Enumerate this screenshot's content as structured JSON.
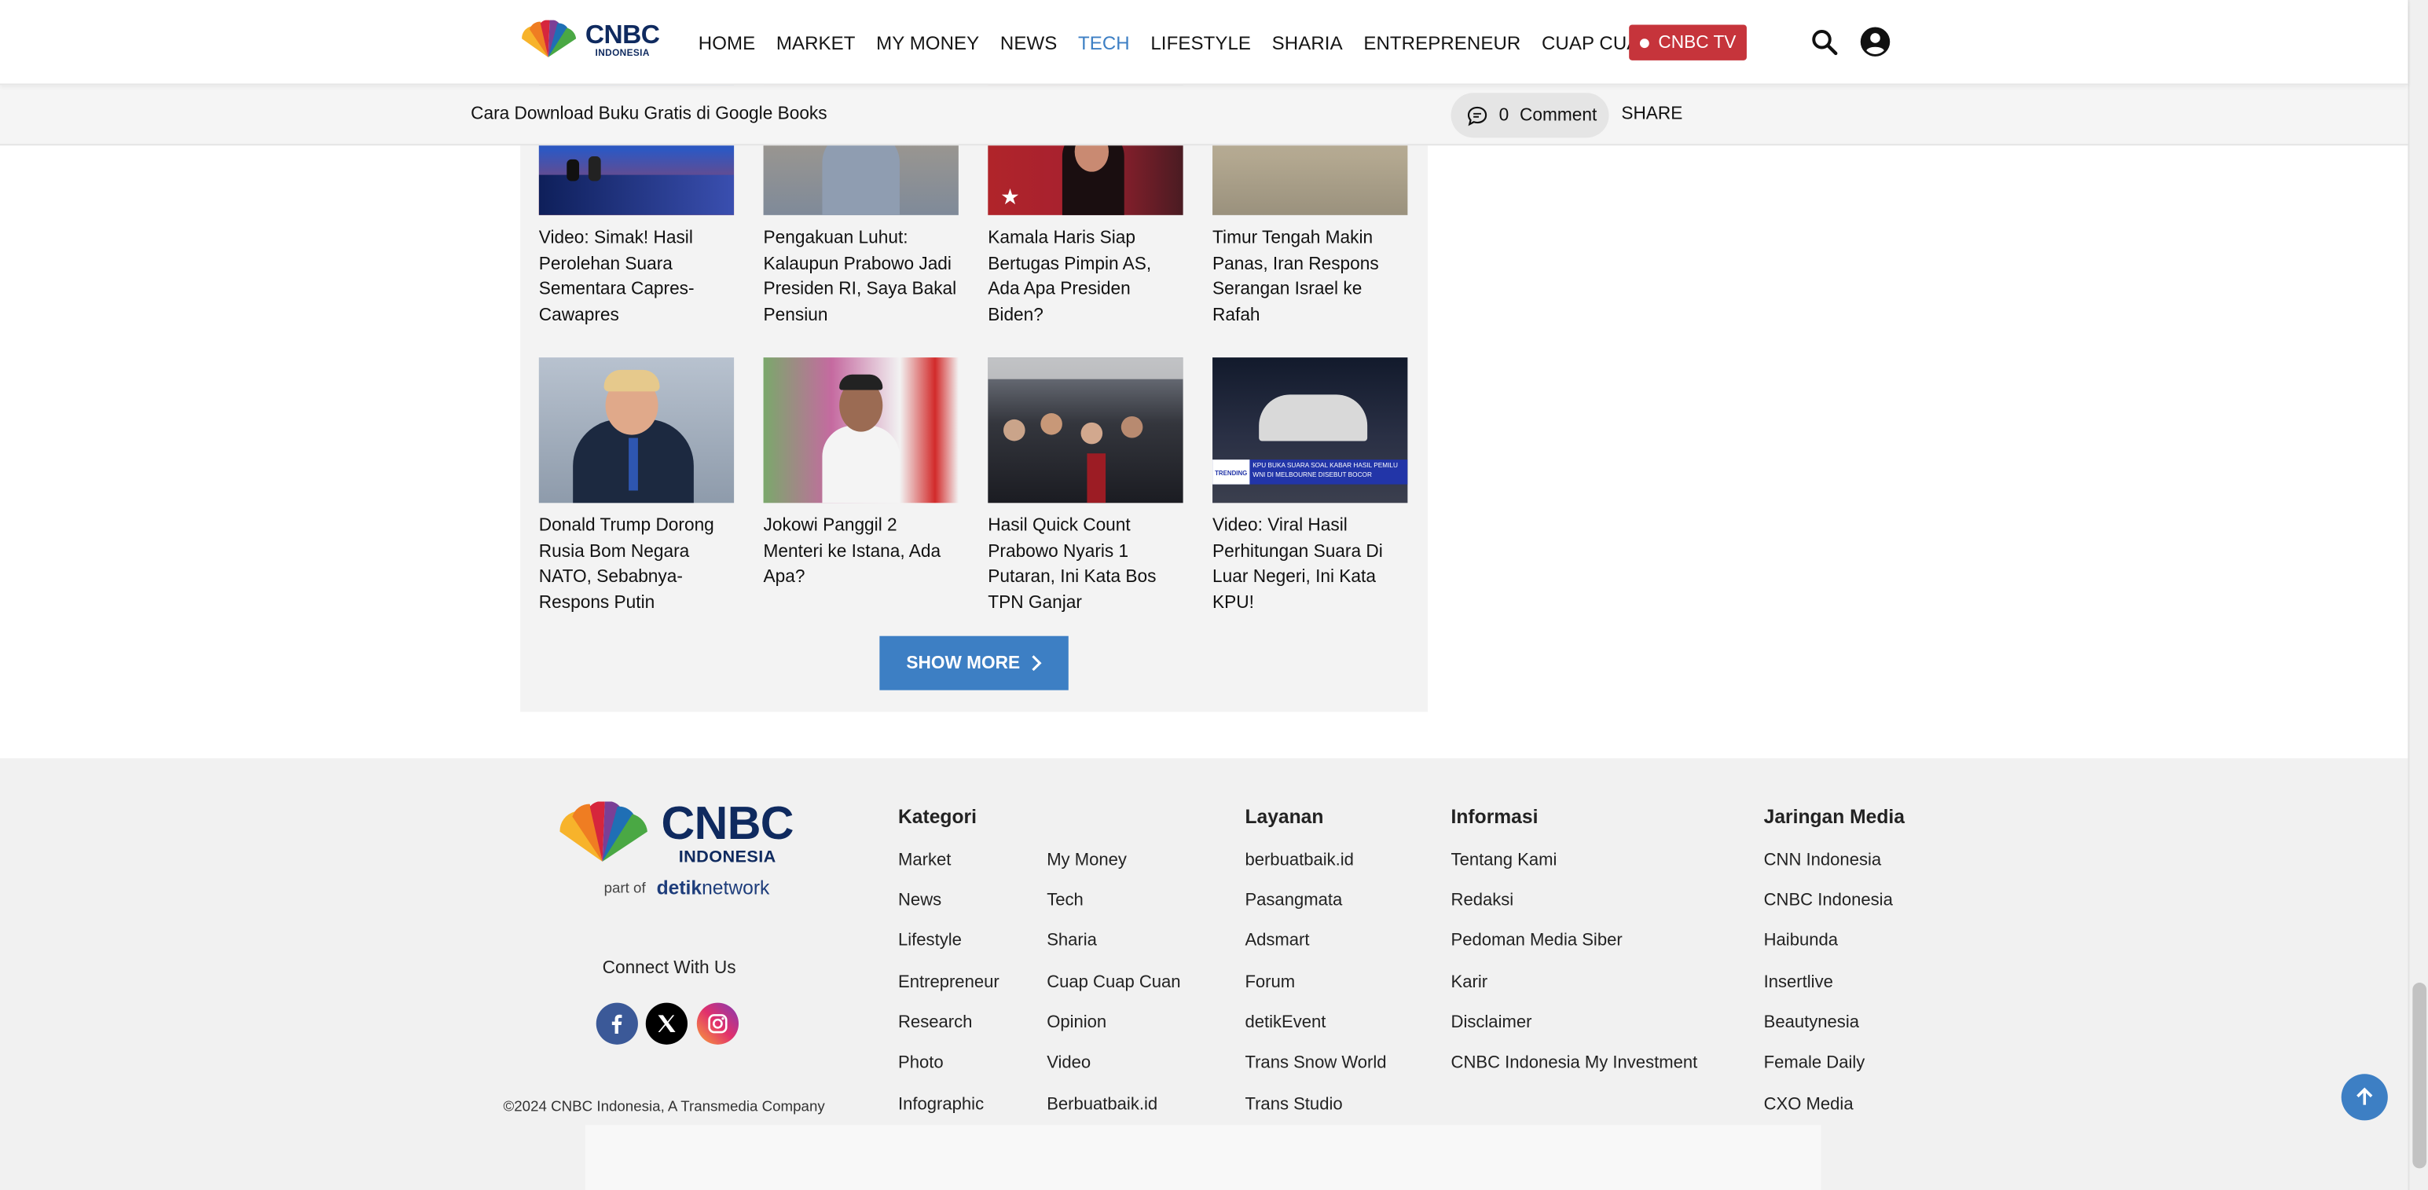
{
  "brand": {
    "name": "CNBC",
    "sub": "INDONESIA"
  },
  "nav": {
    "items": [
      "HOME",
      "MARKET",
      "MY MONEY",
      "NEWS",
      "TECH",
      "LIFESTYLE",
      "SHARIA",
      "ENTREPRENEUR",
      "CUAP CUAP CUAN"
    ],
    "active": "TECH",
    "tv_label": "CNBC TV"
  },
  "sharebar": {
    "article_title": "Cara Download Buku Gratis di Google Books",
    "comment_count": "0",
    "comment_label": "Comment",
    "share_label": "SHARE"
  },
  "related": {
    "cards": [
      {
        "title": "Video: Simak! Hasil Perolehan Suara Sementara Capres-Cawapres"
      },
      {
        "title": "Pengakuan Luhut: Kalaupun Prabowo Jadi Presiden RI, Saya Bakal Pensiun"
      },
      {
        "title": "Kamala Haris Siap Bertugas Pimpin AS, Ada Apa Presiden Biden?"
      },
      {
        "title": "Timur Tengah Makin Panas, Iran Respons Serangan Israel ke Rafah"
      },
      {
        "title": "Donald Trump Dorong Rusia Bom Negara NATO, Sebabnya-Respons Putin"
      },
      {
        "title": "Jokowi Panggil 2 Menteri ke Istana, Ada Apa?"
      },
      {
        "title": "Hasil Quick Count Prabowo Nyaris 1 Putaran, Ini Kata Bos TPN Ganjar"
      },
      {
        "title": "Video: Viral Hasil Perhitungan Suara Di Luar Negeri, Ini Kata KPU!"
      }
    ],
    "thumb_caption": "KPU BUKA SUARA SOAL KABAR HASIL PEMILU WNI DI MELBOURNE DISEBUT BOCOR",
    "thumb_tag": "TRENDING",
    "show_more": "SHOW MORE"
  },
  "footer": {
    "part_of": "part of",
    "detik_a": "detik",
    "detik_b": "network",
    "connect": "Connect With Us",
    "copyright": "©2024 CNBC Indonesia, A Transmedia Company",
    "kategori": {
      "title": "Kategori",
      "col1": [
        "Market",
        "News",
        "Lifestyle",
        "Entrepreneur",
        "Research",
        "Photo",
        "Infographic"
      ],
      "col2": [
        "My Money",
        "Tech",
        "Sharia",
        "Cuap Cuap Cuan",
        "Opinion",
        "Video",
        "Berbuatbaik.id"
      ]
    },
    "layanan": {
      "title": "Layanan",
      "items": [
        "berbuatbaik.id",
        "Pasangmata",
        "Adsmart",
        "Forum",
        "detikEvent",
        "Trans Snow World",
        "Trans Studio"
      ]
    },
    "informasi": {
      "title": "Informasi",
      "items": [
        "Tentang Kami",
        "Redaksi",
        "Pedoman Media Siber",
        "Karir",
        "Disclaimer",
        "CNBC Indonesia My Investment"
      ]
    },
    "jaringan": {
      "title": "Jaringan Media",
      "items": [
        "CNN Indonesia",
        "CNBC Indonesia",
        "Haibunda",
        "Insertlive",
        "Beautynesia",
        "Female Daily",
        "CXO Media"
      ]
    }
  },
  "colors": {
    "accent": "#3d7fc4",
    "tv_red": "#c6343b",
    "facebook": "#3b5998",
    "whatsapp": "#4cc552",
    "telegram": "#2fa6d9"
  }
}
